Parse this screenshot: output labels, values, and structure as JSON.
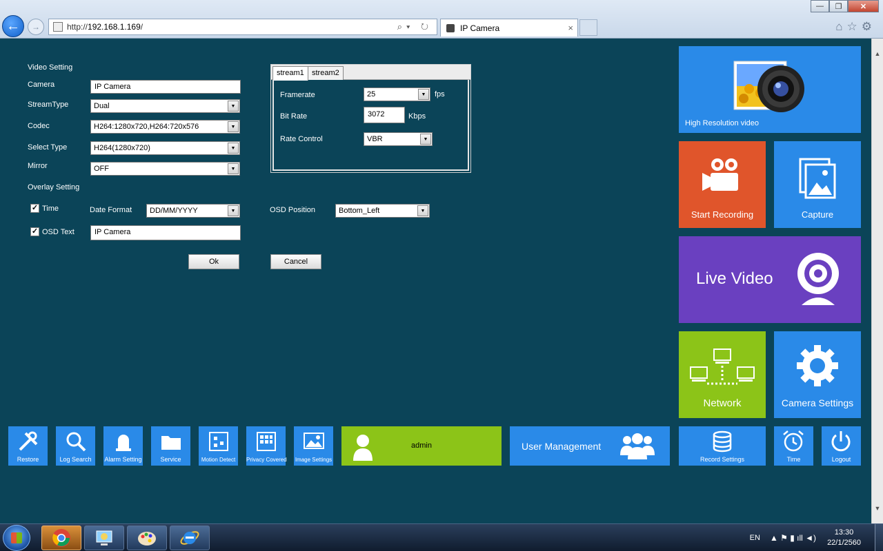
{
  "browser": {
    "url_prefix": "http://",
    "url_host": "192.168.1.169",
    "url_suffix": "/",
    "tab_title": "IP Camera",
    "tab_close": "×",
    "window_controls": {
      "minimize": "—",
      "maximize": "❐",
      "close": "✕"
    },
    "addr_icons": "⌕▾ ↻"
  },
  "settings": {
    "video_setting_heading": "Video Setting",
    "camera_label": "Camera",
    "camera_value": "IP Camera",
    "stream_type_label": "StreamType",
    "stream_type_value": "Dual",
    "codec_label": "Codec",
    "codec_value": "H264:1280x720,H264:720x576",
    "select_type_label": "Select Type",
    "select_type_value": "H264(1280x720)",
    "mirror_label": "Mirror",
    "mirror_value": "OFF",
    "overlay_heading": "Overlay Setting",
    "time_label": "Time",
    "time_checked": "✓",
    "date_format_label": "Date Format",
    "date_format_value": "DD/MM/YYYY",
    "osd_position_label": "OSD Position",
    "osd_position_value": "Bottom_Left",
    "osd_text_label": "OSD Text",
    "osd_text_checked": "✓",
    "osd_text_value": "IP Camera",
    "ok_label": "Ok",
    "cancel_label": "Cancel",
    "dropdown_glyph": "▼"
  },
  "stream": {
    "tabs": [
      "stream1",
      "stream2"
    ],
    "framerate_label": "Framerate",
    "framerate_value": "25",
    "framerate_unit": "fps",
    "bitrate_label": "Bit Rate",
    "bitrate_value": "3072",
    "bitrate_unit": "Kbps",
    "rate_control_label": "Rate Control",
    "rate_control_value": "VBR"
  },
  "tiles": {
    "high_res": "High Resolution video",
    "start_recording": "Start Recording",
    "capture": "Capture",
    "live_video": "Live Video",
    "network": "Network",
    "camera_settings": "Camera Settings"
  },
  "bottom_bar": {
    "items": [
      "Restore",
      "Log Search",
      "Alarm Setting",
      "Service",
      "Motion Detect",
      "Privacy Covered",
      "Image Settings"
    ],
    "user": "admin",
    "user_management": "User Management",
    "record_settings": "Record Settings",
    "time": "Time",
    "logout": "Logout"
  },
  "colors": {
    "page_bg": "#0b4458",
    "blue_tile": "#2a8ae8",
    "orange_tile": "#e0552b",
    "purple_tile": "#6a40c0",
    "green_tile": "#8cc418"
  },
  "taskbar": {
    "lang": "EN",
    "time": "13:30",
    "date": "22/1/2560",
    "tray_icons": "▲  ⚑  ▮  ıll  ◄)"
  }
}
